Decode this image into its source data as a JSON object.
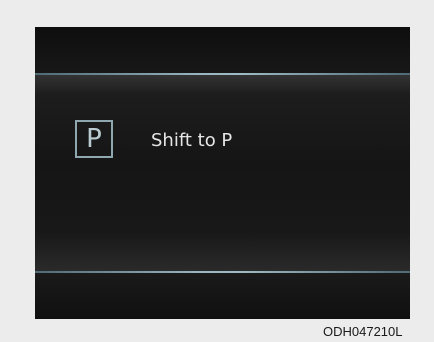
{
  "display": {
    "gear_indicator": "P",
    "message": "Shift to P"
  },
  "figure_code": "ODH047210L",
  "colors": {
    "screen_background": "#141414",
    "accent_line": "#9cb7bf",
    "gear_box_border": "#8fa7ae",
    "message_text": "#e6e6e6",
    "page_background": "#ececec"
  }
}
